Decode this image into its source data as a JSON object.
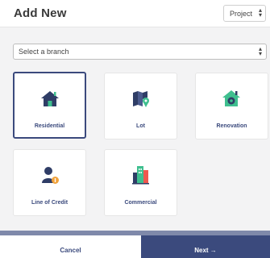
{
  "header": {
    "title": "Add New",
    "type_select": "Project"
  },
  "branch_select": {
    "value": "Select a branch"
  },
  "tiles": [
    {
      "label": "Residential",
      "icon": "house-icon",
      "selected": true
    },
    {
      "label": "Lot",
      "icon": "map-pin-icon",
      "selected": false
    },
    {
      "label": "Renovation",
      "icon": "house-gear-icon",
      "selected": false
    },
    {
      "label": "Line of Credit",
      "icon": "person-coin-icon",
      "selected": false
    },
    {
      "label": "Commercial",
      "icon": "building-icon",
      "selected": false
    }
  ],
  "footer": {
    "cancel_label": "Cancel",
    "next_label": "Next →"
  },
  "colors": {
    "accent": "#3b4a7d",
    "icon_dark": "#2f3d66",
    "icon_green": "#3fbf8f",
    "icon_orange": "#f0a23b",
    "background": "#f3f3f4"
  }
}
